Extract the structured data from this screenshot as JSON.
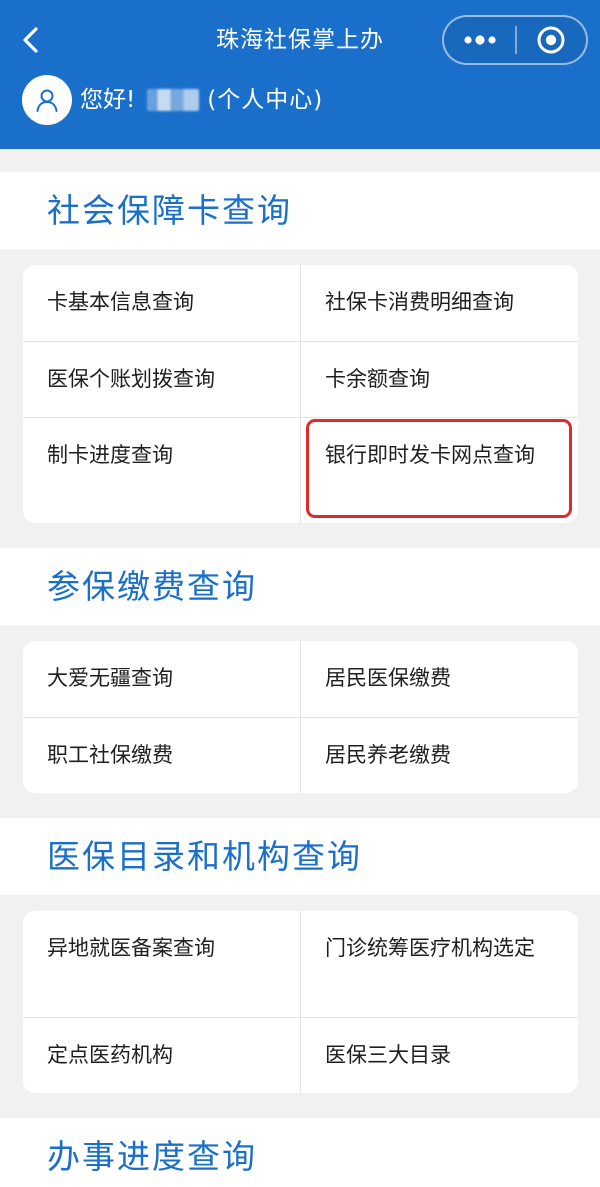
{
  "header": {
    "title": "珠海社保掌上办",
    "greeting": "您好!",
    "personal_center": "(个人中心)",
    "icons": {
      "back": "chevron-left-icon",
      "more": "more-dots-icon",
      "close": "target-circle-icon",
      "avatar": "user-icon"
    },
    "accent": "#1a6fca"
  },
  "sections": [
    {
      "title": "社会保障卡查询",
      "items": [
        "卡基本信息查询",
        "社保卡消费明细查询",
        "医保个账划拨查询",
        "卡余额查询",
        "制卡进度查询",
        "银行即时发卡网点查询"
      ]
    },
    {
      "title": "参保缴费查询",
      "items": [
        "大爱无疆查询",
        "居民医保缴费",
        "职工社保缴费",
        "居民养老缴费"
      ]
    },
    {
      "title": "医保目录和机构查询",
      "items": [
        "异地就医备案查询",
        "门诊统筹医疗机构选定",
        "定点医药机构",
        "医保三大目录"
      ]
    },
    {
      "title": "办事进度查询",
      "items": []
    }
  ],
  "highlight_color": "#e02a2a"
}
